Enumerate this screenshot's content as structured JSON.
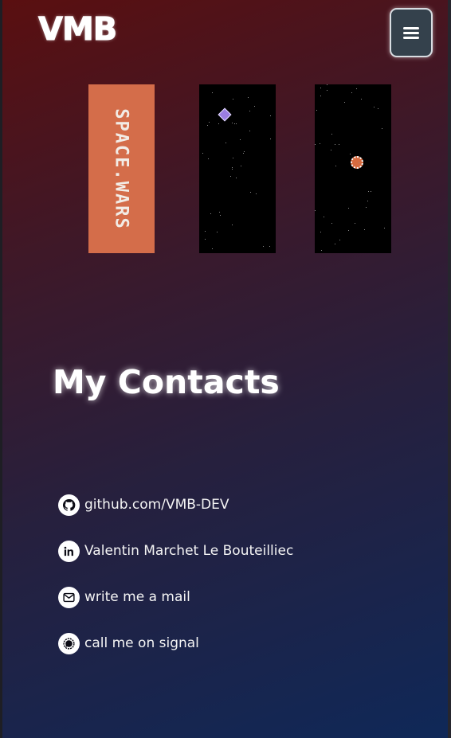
{
  "header": {
    "logo_text": "VMB",
    "menu_icon": "hamburger-menu-icon"
  },
  "projects": {
    "title_card_text": "SPACE.WARS",
    "title_card_color": "#d46d4a",
    "screen_background": "#000000"
  },
  "contacts": {
    "heading": "My Contacts",
    "items": [
      {
        "icon": "github-icon",
        "label": "github.com/VMB-DEV"
      },
      {
        "icon": "linkedin-icon",
        "label": "Valentin Marchet Le Bouteilliec"
      },
      {
        "icon": "mail-icon",
        "label": "write me a mail"
      },
      {
        "icon": "signal-icon",
        "label": "call me on signal"
      }
    ]
  },
  "colors": {
    "gradient_top": "#5a0f10",
    "gradient_bottom": "#0f2858",
    "text": "#ffffff"
  }
}
